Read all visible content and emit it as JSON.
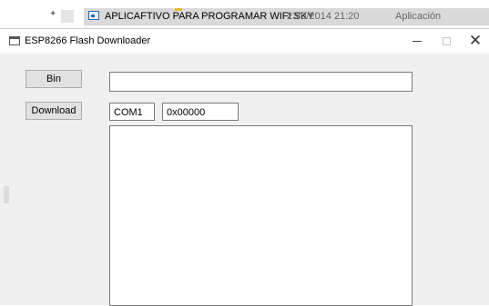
{
  "background": {
    "file_name": "APLICAFTIVO PARA PROGRAMAR WIFI SKY",
    "file_date": "23/9/2014 21:20",
    "file_type": "Aplicación"
  },
  "window": {
    "title": "ESP8266 Flash Downloader",
    "controls": {
      "minimize": "—",
      "maximize": "□",
      "close": "✕"
    }
  },
  "form": {
    "bin_button_label": "Bin",
    "download_button_label": "Download",
    "bin_path_value": "",
    "com_port_value": "COM1",
    "address_value": "0x00000",
    "log_text": ""
  }
}
